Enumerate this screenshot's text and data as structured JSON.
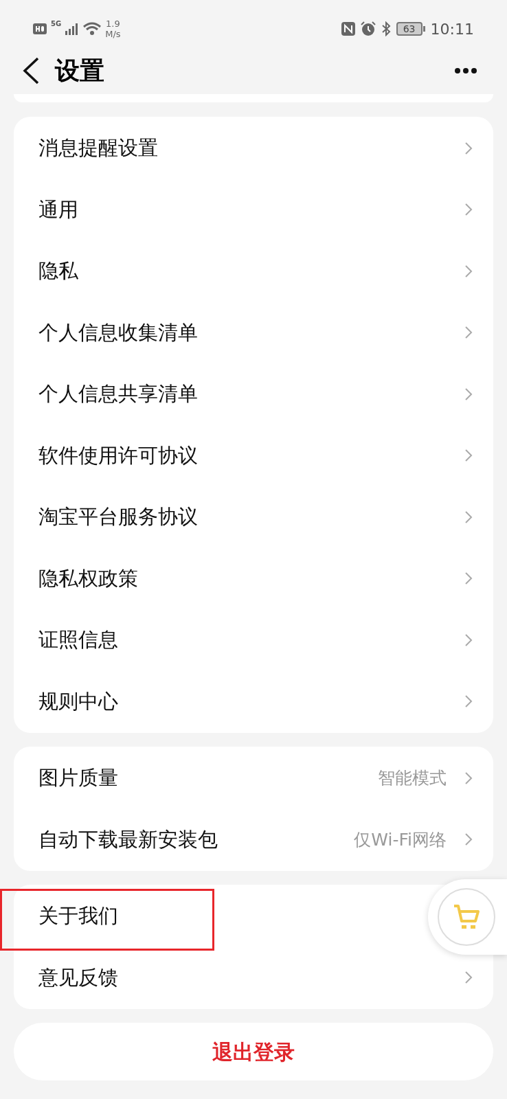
{
  "status_bar": {
    "network": "5G",
    "speed_value": "1.9",
    "speed_unit": "M/s",
    "battery": "63",
    "time": "10:11"
  },
  "header": {
    "title": "设置"
  },
  "groups": [
    {
      "items": [
        {
          "label": "消息提醒设置"
        },
        {
          "label": "通用"
        },
        {
          "label": "隐私"
        },
        {
          "label": "个人信息收集清单"
        },
        {
          "label": "个人信息共享清单"
        },
        {
          "label": "软件使用许可协议"
        },
        {
          "label": "淘宝平台服务协议"
        },
        {
          "label": "隐私权政策"
        },
        {
          "label": "证照信息"
        },
        {
          "label": "规则中心"
        }
      ]
    },
    {
      "items": [
        {
          "label": "图片质量",
          "value": "智能模式"
        },
        {
          "label": "自动下载最新安装包",
          "value": "仅Wi-Fi网络"
        }
      ]
    },
    {
      "items": [
        {
          "kind": "cart",
          "label": "关于我们",
          "highlighted": true
        },
        {
          "kind": "link",
          "label": "意见反馈",
          "highlighted": false
        }
      ]
    }
  ],
  "logout_button": "退出登录"
}
